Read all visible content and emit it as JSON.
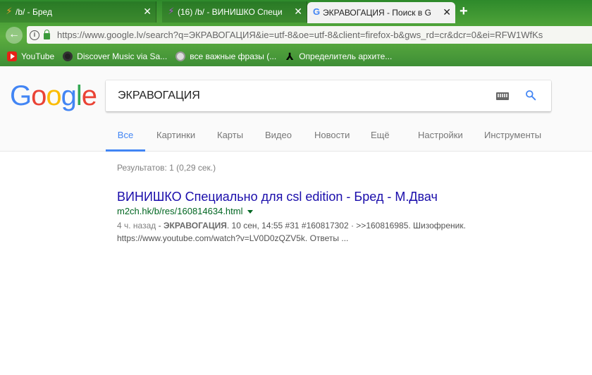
{
  "browser": {
    "tabs": [
      {
        "title": "/b/ - Бред",
        "icon": "flash-icon",
        "active": false
      },
      {
        "title": "(16) /b/ - ВИНИШКО Специ",
        "icon": "flash-icon",
        "active": false
      },
      {
        "title": "ЭКРАВОГАЦИЯ - Поиск в G",
        "icon": "google-icon",
        "active": true
      }
    ],
    "new_tab": "+",
    "close_glyph": "✕",
    "url": "https://www.google.lv/search?q=ЭКРАВОГАЦИЯ&ie=utf-8&oe=utf-8&client=firefox-b&gws_rd=cr&dcr=0&ei=RFW1WfKs",
    "bookmarks": [
      {
        "label": "YouTube",
        "icon": "youtube-icon"
      },
      {
        "label": "Discover Music via Sa...",
        "icon": "disc-icon"
      },
      {
        "label": "все важные фразы (...",
        "icon": "globe-icon"
      },
      {
        "label": "Определитель архите...",
        "icon": "architect-icon"
      }
    ]
  },
  "google": {
    "logo": [
      "G",
      "o",
      "o",
      "g",
      "l",
      "e"
    ],
    "logo_colors": [
      "#4285f4",
      "#ea4335",
      "#fbbc05",
      "#4285f4",
      "#34a853",
      "#ea4335"
    ],
    "query": "ЭКРАВОГАЦИЯ",
    "nav_tabs": [
      "Все",
      "Картинки",
      "Карты",
      "Видео",
      "Новости",
      "Ещё",
      "Настройки",
      "Инструменты"
    ],
    "selected_tab": "Все",
    "stats": "Результатов: 1 (0,29 сек.)",
    "result": {
      "title": "ВИНИШКО Специально для csl edition - Бред - М.Двач",
      "url": "m2ch.hk/b/res/160814634.html",
      "date": "4 ч. назад",
      "separator": " - ",
      "snippet_bold": "ЭКРАВОГАЦИЯ",
      "snippet_rest": ". 10 сен, 14:55 #31 #160817302 · >>160816985. Шизофреник.",
      "snippet_line2": "https://www.youtube.com/watch?v=LV0D0zQZV5k. Ответы ..."
    }
  },
  "colors": {
    "link": "#1a0dab",
    "url_green": "#006621",
    "accent_blue": "#4285f4"
  }
}
